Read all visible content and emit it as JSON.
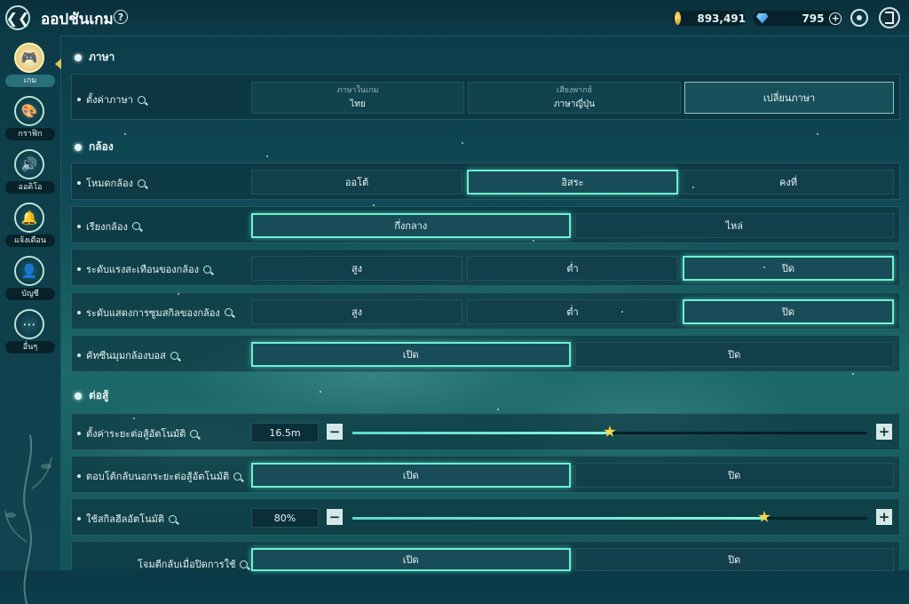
{
  "header": {
    "title": "ออปชันเกม",
    "help": "?",
    "coins": "893,491",
    "gems": "795",
    "gems_plus": "+"
  },
  "sidebar": {
    "items": [
      {
        "label": "เกม",
        "icon": "gamepad-icon",
        "glyph": "🎮",
        "active": true
      },
      {
        "label": "กราฟิก",
        "icon": "palette-icon",
        "glyph": "🎨",
        "active": false
      },
      {
        "label": "ออดิโอ",
        "icon": "speaker-icon",
        "glyph": "🔊",
        "active": false
      },
      {
        "label": "แจ้งเตือน",
        "icon": "bell-icon",
        "glyph": "🔔",
        "active": false
      },
      {
        "label": "บัญชี",
        "icon": "user-icon",
        "glyph": "👤",
        "active": false
      },
      {
        "label": "อื่นๆ",
        "icon": "more-icon",
        "glyph": "⋯",
        "active": false
      }
    ]
  },
  "sections": {
    "language": "ภาษา",
    "camera": "กล้อง",
    "combat": "ต่อสู้"
  },
  "language_row": {
    "label": "ตั้งค่าภาษา",
    "game_lang_title": "ภาษาในเกม",
    "game_lang_value": "ไทย",
    "voice_title": "เสียงพากย์",
    "voice_value": "ภาษาญี่ปุ่น",
    "change_button": "เปลี่ยนภาษา"
  },
  "camera_rows": [
    {
      "label": "โหมดกล้อง",
      "options": [
        "ออโต้",
        "อิสระ",
        "คงที่"
      ],
      "selected": 1
    },
    {
      "label": "เรียงกล้อง",
      "options": [
        "กึ่งกลาง",
        "ไหล่"
      ],
      "selected": 0
    },
    {
      "label": "ระดับแรงสะเทือนของกล้อง",
      "options": [
        "สูง",
        "ต่ำ",
        "ปิด"
      ],
      "selected": 2
    },
    {
      "label": "ระดับแสดงการซูมสกิลของกล้อง",
      "options": [
        "สูง",
        "ต่ำ",
        "ปิด"
      ],
      "selected": 2
    },
    {
      "label": "คัทซีนมุมกล้องบอส",
      "options": [
        "เปิด",
        "ปิด"
      ],
      "selected": 0
    }
  ],
  "combat_rows": {
    "auto_range": {
      "label": "ตั้งค่าระยะต่อสู้อัตโนมัติ",
      "value": "16.5m",
      "fraction": 0.5,
      "minus": "−",
      "plus": "+"
    },
    "auto_return": {
      "label": "ตอบโต้กลับนอกระยะต่อสู้อัตโนมัติ",
      "options": [
        "เปิด",
        "ปิด"
      ],
      "selected": 0
    },
    "auto_skill": {
      "label": "ใช้สกิลฮีลอัตโนมัติ",
      "value": "80%",
      "fraction": 0.8,
      "minus": "−",
      "plus": "+"
    },
    "counter": {
      "label": "โจมตีกลับเมื่อปิดการใช้",
      "options": [
        "เปิด",
        "ปิด"
      ],
      "selected": 0
    }
  },
  "colors": {
    "accent": "#6ff0d2",
    "star": "#ffd84a"
  }
}
